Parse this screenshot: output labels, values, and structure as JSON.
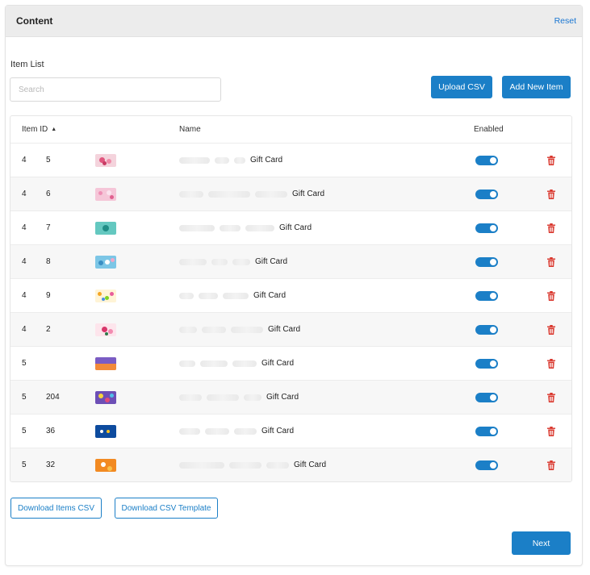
{
  "panel": {
    "title": "Content",
    "reset_label": "Reset"
  },
  "item_list": {
    "label": "Item List",
    "search_placeholder": "Search",
    "upload_label": "Upload CSV",
    "add_label": "Add New Item"
  },
  "table": {
    "headers": {
      "item_id": "Item ID",
      "name": "Name",
      "enabled": "Enabled"
    },
    "sort_indicator": "▲",
    "rows": [
      {
        "id_a": "4",
        "id_b": "5",
        "name": "Gift Card",
        "enabled": true,
        "thumb": "pink-flowers"
      },
      {
        "id_a": "4",
        "id_b": "6",
        "name": "Gift Card",
        "enabled": true,
        "thumb": "pink-pattern"
      },
      {
        "id_a": "4",
        "id_b": "7",
        "name": "Gift Card",
        "enabled": true,
        "thumb": "teal-heart"
      },
      {
        "id_a": "4",
        "id_b": "8",
        "name": "Gift Card",
        "enabled": true,
        "thumb": "thanks-blue"
      },
      {
        "id_a": "4",
        "id_b": "9",
        "name": "Gift Card",
        "enabled": true,
        "thumb": "confetti"
      },
      {
        "id_a": "4",
        "id_b": "2",
        "name": "Gift Card",
        "enabled": true,
        "thumb": "pink-bouquet"
      },
      {
        "id_a": "5",
        "id_b": "",
        "name": "Gift Card",
        "enabled": true,
        "thumb": "sunset"
      },
      {
        "id_a": "5",
        "id_b": "204",
        "name": "Gift Card",
        "enabled": true,
        "thumb": "colorful-blocks"
      },
      {
        "id_a": "5",
        "id_b": "36",
        "name": "Gift Card",
        "enabled": true,
        "thumb": "walmart-blue"
      },
      {
        "id_a": "5",
        "id_b": "32",
        "name": "Gift Card",
        "enabled": true,
        "thumb": "orange-hello"
      }
    ]
  },
  "footer": {
    "download_items_label": "Download Items CSV",
    "download_template_label": "Download CSV Template",
    "next_label": "Next"
  },
  "colors": {
    "primary": "#1b7fc7",
    "delete": "#d9352b",
    "header_bg": "#ececec"
  },
  "icons": {
    "sort": "triangle-up",
    "delete": "trash-icon"
  }
}
